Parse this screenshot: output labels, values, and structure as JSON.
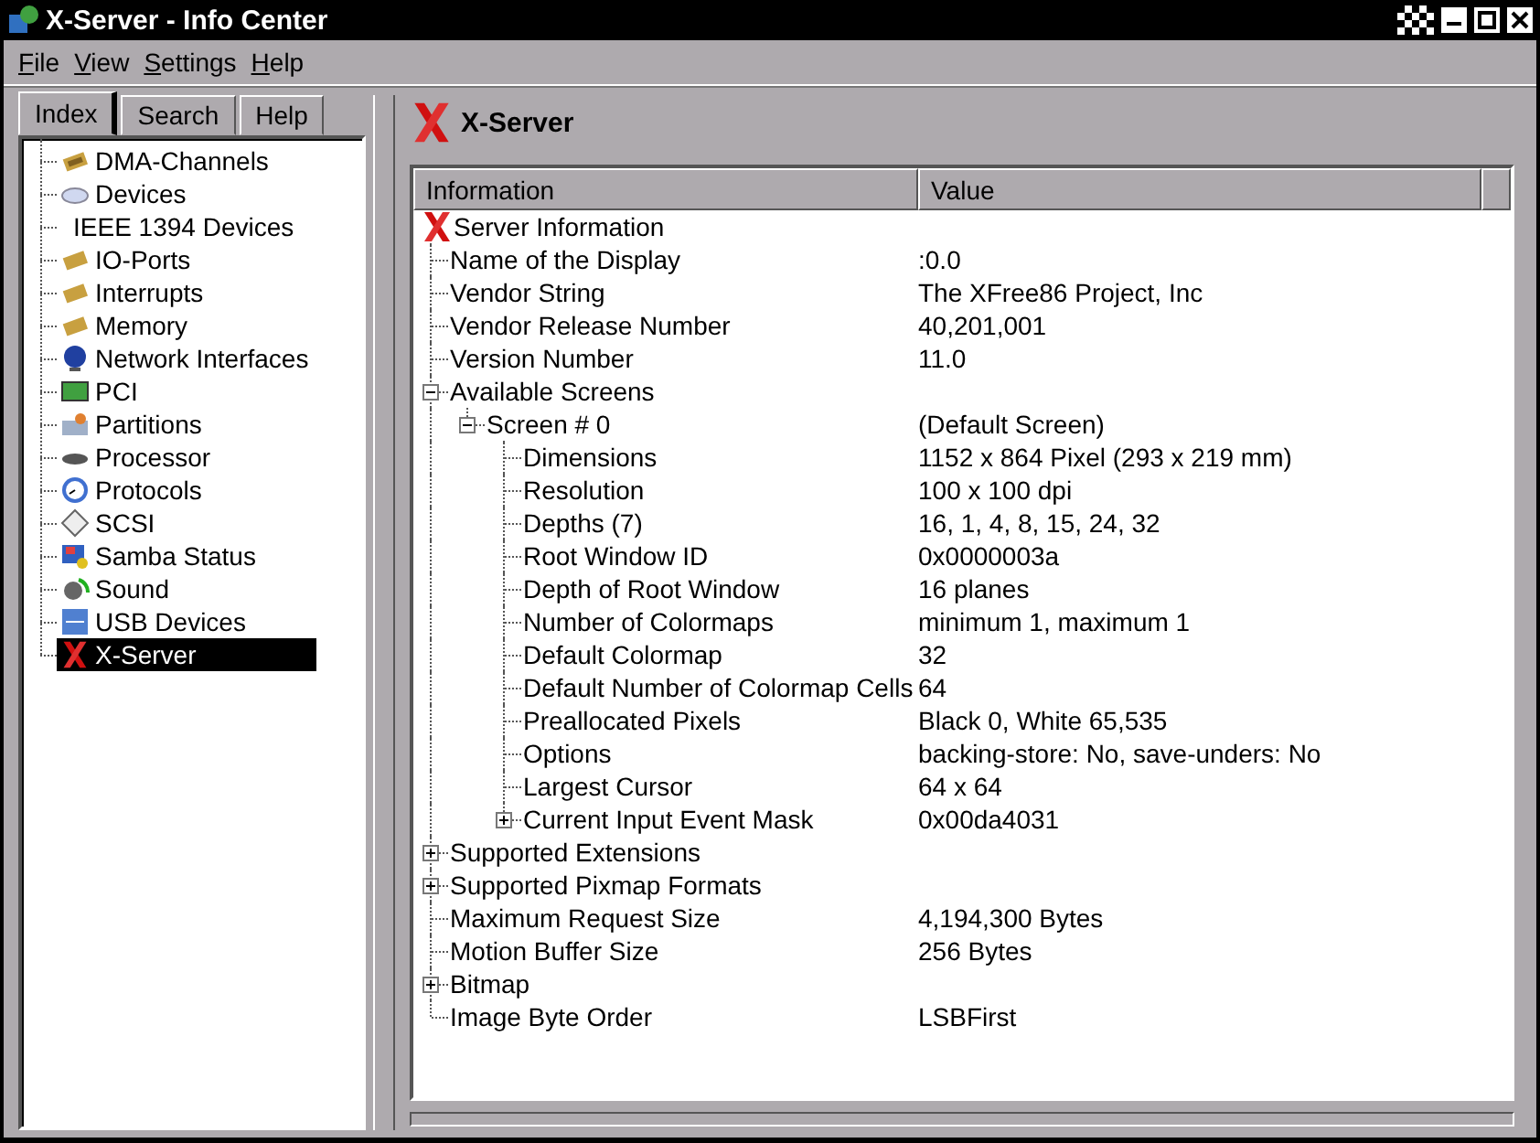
{
  "window": {
    "title": "X-Server - Info Center"
  },
  "menu": [
    "File",
    "View",
    "Settings",
    "Help"
  ],
  "sidebar": {
    "tabs": [
      {
        "label": "Index",
        "selected": true
      },
      {
        "label": "Search",
        "selected": false
      },
      {
        "label": "Help",
        "selected": false
      }
    ],
    "items": [
      {
        "label": "DMA-Channels",
        "selected": false
      },
      {
        "label": "Devices",
        "selected": false
      },
      {
        "label": "IEEE 1394 Devices",
        "selected": false
      },
      {
        "label": "IO-Ports",
        "selected": false
      },
      {
        "label": "Interrupts",
        "selected": false
      },
      {
        "label": "Memory",
        "selected": false
      },
      {
        "label": "Network Interfaces",
        "selected": false
      },
      {
        "label": "PCI",
        "selected": false
      },
      {
        "label": "Partitions",
        "selected": false
      },
      {
        "label": "Processor",
        "selected": false
      },
      {
        "label": "Protocols",
        "selected": false
      },
      {
        "label": "SCSI",
        "selected": false
      },
      {
        "label": "Samba Status",
        "selected": false
      },
      {
        "label": "Sound",
        "selected": false
      },
      {
        "label": "USB Devices",
        "selected": false
      },
      {
        "label": "X-Server",
        "selected": true
      }
    ]
  },
  "module": {
    "title": "X-Server"
  },
  "table": {
    "columns": [
      "Information",
      "Value"
    ],
    "tree": [
      {
        "label": "Server Information",
        "children": [
          {
            "label": "Name of the Display",
            "value": ":0.0"
          },
          {
            "label": "Vendor String",
            "value": "The XFree86 Project, Inc"
          },
          {
            "label": "Vendor Release Number",
            "value": "40,201,001"
          },
          {
            "label": "Version Number",
            "value": "11.0"
          },
          {
            "label": "Available Screens",
            "expanded": true,
            "children": [
              {
                "label": "Screen # 0",
                "value": "(Default Screen)",
                "expanded": true,
                "children": [
                  {
                    "label": "Dimensions",
                    "value": "1152 x 864 Pixel (293 x 219 mm)"
                  },
                  {
                    "label": "Resolution",
                    "value": "100 x 100 dpi"
                  },
                  {
                    "label": "Depths (7)",
                    "value": "16, 1, 4, 8, 15, 24, 32"
                  },
                  {
                    "label": "Root Window ID",
                    "value": "0x0000003a"
                  },
                  {
                    "label": "Depth of Root Window",
                    "value": "16 planes"
                  },
                  {
                    "label": "Number of Colormaps",
                    "value": "minimum 1, maximum 1"
                  },
                  {
                    "label": "Default Colormap",
                    "value": "32"
                  },
                  {
                    "label": "Default Number of Colormap Cells",
                    "value": "64"
                  },
                  {
                    "label": "Preallocated Pixels",
                    "value": "Black 0, White 65,535"
                  },
                  {
                    "label": "Options",
                    "value": "backing-store: No, save-unders: No"
                  },
                  {
                    "label": "Largest Cursor",
                    "value": "64 x 64"
                  },
                  {
                    "label": "Current Input Event Mask",
                    "value": "0x00da4031",
                    "expanded": false
                  }
                ]
              }
            ]
          },
          {
            "label": "Supported Extensions",
            "expanded": false
          },
          {
            "label": "Supported Pixmap Formats",
            "expanded": false
          },
          {
            "label": "Maximum Request Size",
            "value": "4,194,300 Bytes"
          },
          {
            "label": "Motion Buffer Size",
            "value": "256 Bytes"
          },
          {
            "label": "Bitmap",
            "expanded": false
          },
          {
            "label": "Image Byte Order",
            "value": "LSBFirst"
          }
        ]
      }
    ]
  }
}
